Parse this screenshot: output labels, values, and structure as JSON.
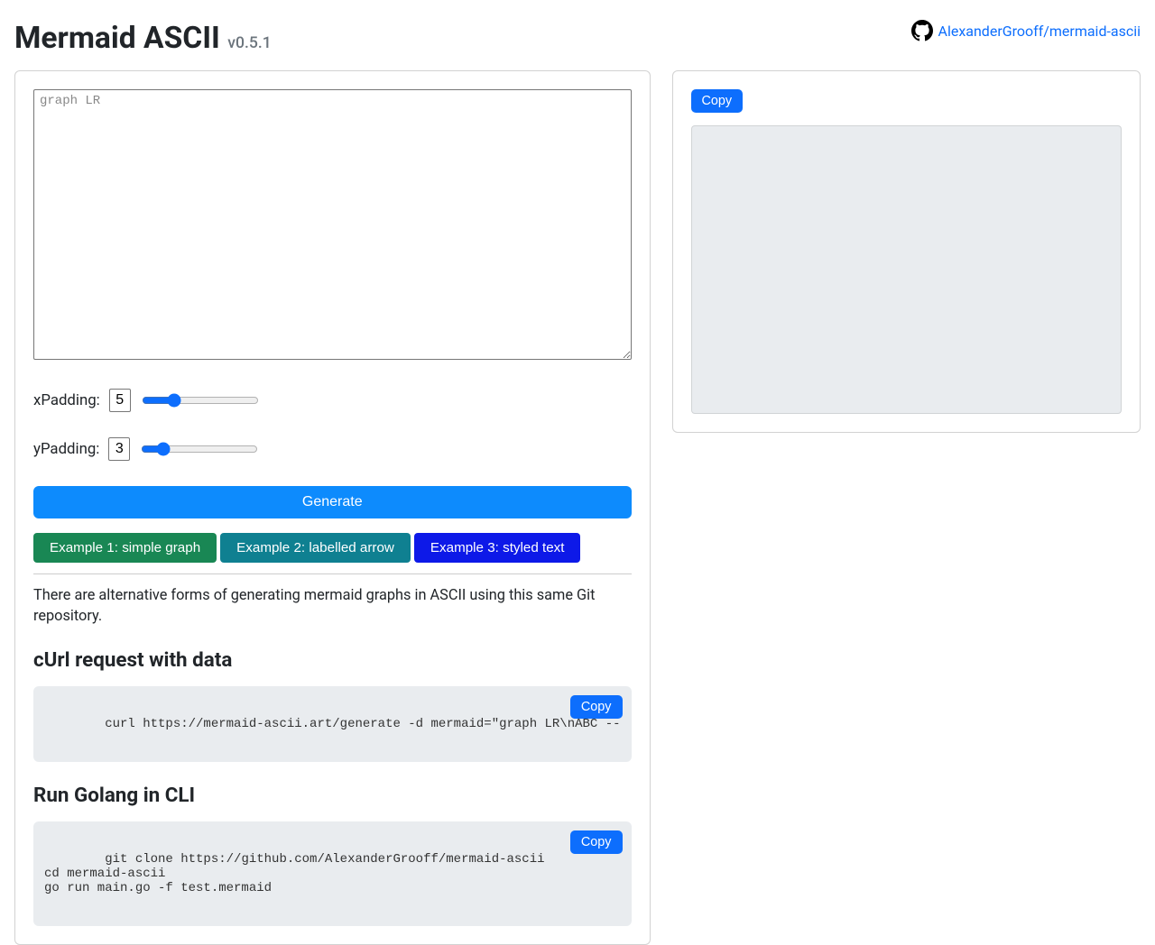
{
  "header": {
    "title": "Mermaid ASCII",
    "version": "v0.5.1",
    "repo_text": "AlexanderGrooff/mermaid-ascii"
  },
  "input": {
    "mermaid_placeholder": "graph LR",
    "mermaid_value": "graph LR",
    "xpadding_label": "xPadding:",
    "xpadding_value": "5",
    "xpadding_min": "0",
    "xpadding_max": "20",
    "ypadding_label": "yPadding:",
    "ypadding_value": "3",
    "ypadding_min": "0",
    "ypadding_max": "20",
    "generate_label": "Generate"
  },
  "examples": {
    "ex1": "Example 1: simple graph",
    "ex2": "Example 2: labelled arrow",
    "ex3": "Example 3: styled text"
  },
  "alt": {
    "description": "There are alternative forms of generating mermaid graphs in ASCII using this same Git repository.",
    "curl_heading": "cUrl request with data",
    "curl_code": "curl https://mermaid-ascii.art/generate -d mermaid=\"graph LR\\nABC --",
    "cli_heading": "Run Golang in CLI",
    "cli_code": "git clone https://github.com/AlexanderGrooff/mermaid-ascii\ncd mermaid-ascii\ngo run main.go -f test.mermaid",
    "copy_label": "Copy"
  },
  "output": {
    "copy_label": "Copy",
    "content": ""
  }
}
